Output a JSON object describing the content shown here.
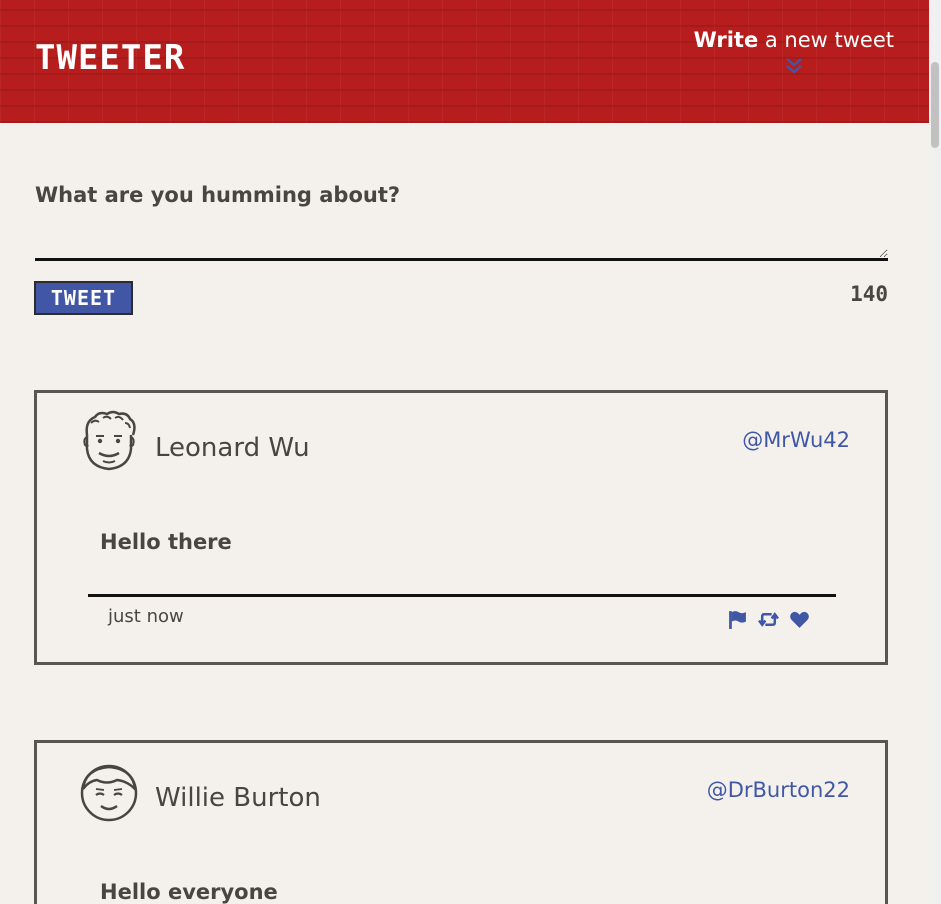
{
  "header": {
    "logo": "TWEETER",
    "compose_toggle_bold": "Write",
    "compose_toggle_rest": " a new tweet"
  },
  "compose": {
    "prompt": "What are you humming about?",
    "input_value": "",
    "submit_label": "TWEET",
    "char_counter": "140"
  },
  "tweets": [
    {
      "name": "Leonard Wu",
      "handle": "@MrWu42",
      "content": "Hello there",
      "timestamp": "just now",
      "avatar_icon": "curly-hair-face-icon",
      "actions": [
        "flag-icon",
        "retweet-icon",
        "heart-icon"
      ]
    },
    {
      "name": "Willie Burton",
      "handle": "@DrBurton22",
      "content": "Hello everyone",
      "avatar_icon": "smiling-face-icon"
    }
  ],
  "colors": {
    "header_bg": "#b81d1d",
    "accent": "#4157a6",
    "page_bg": "#f4f1ec",
    "text": "#4a4540"
  }
}
